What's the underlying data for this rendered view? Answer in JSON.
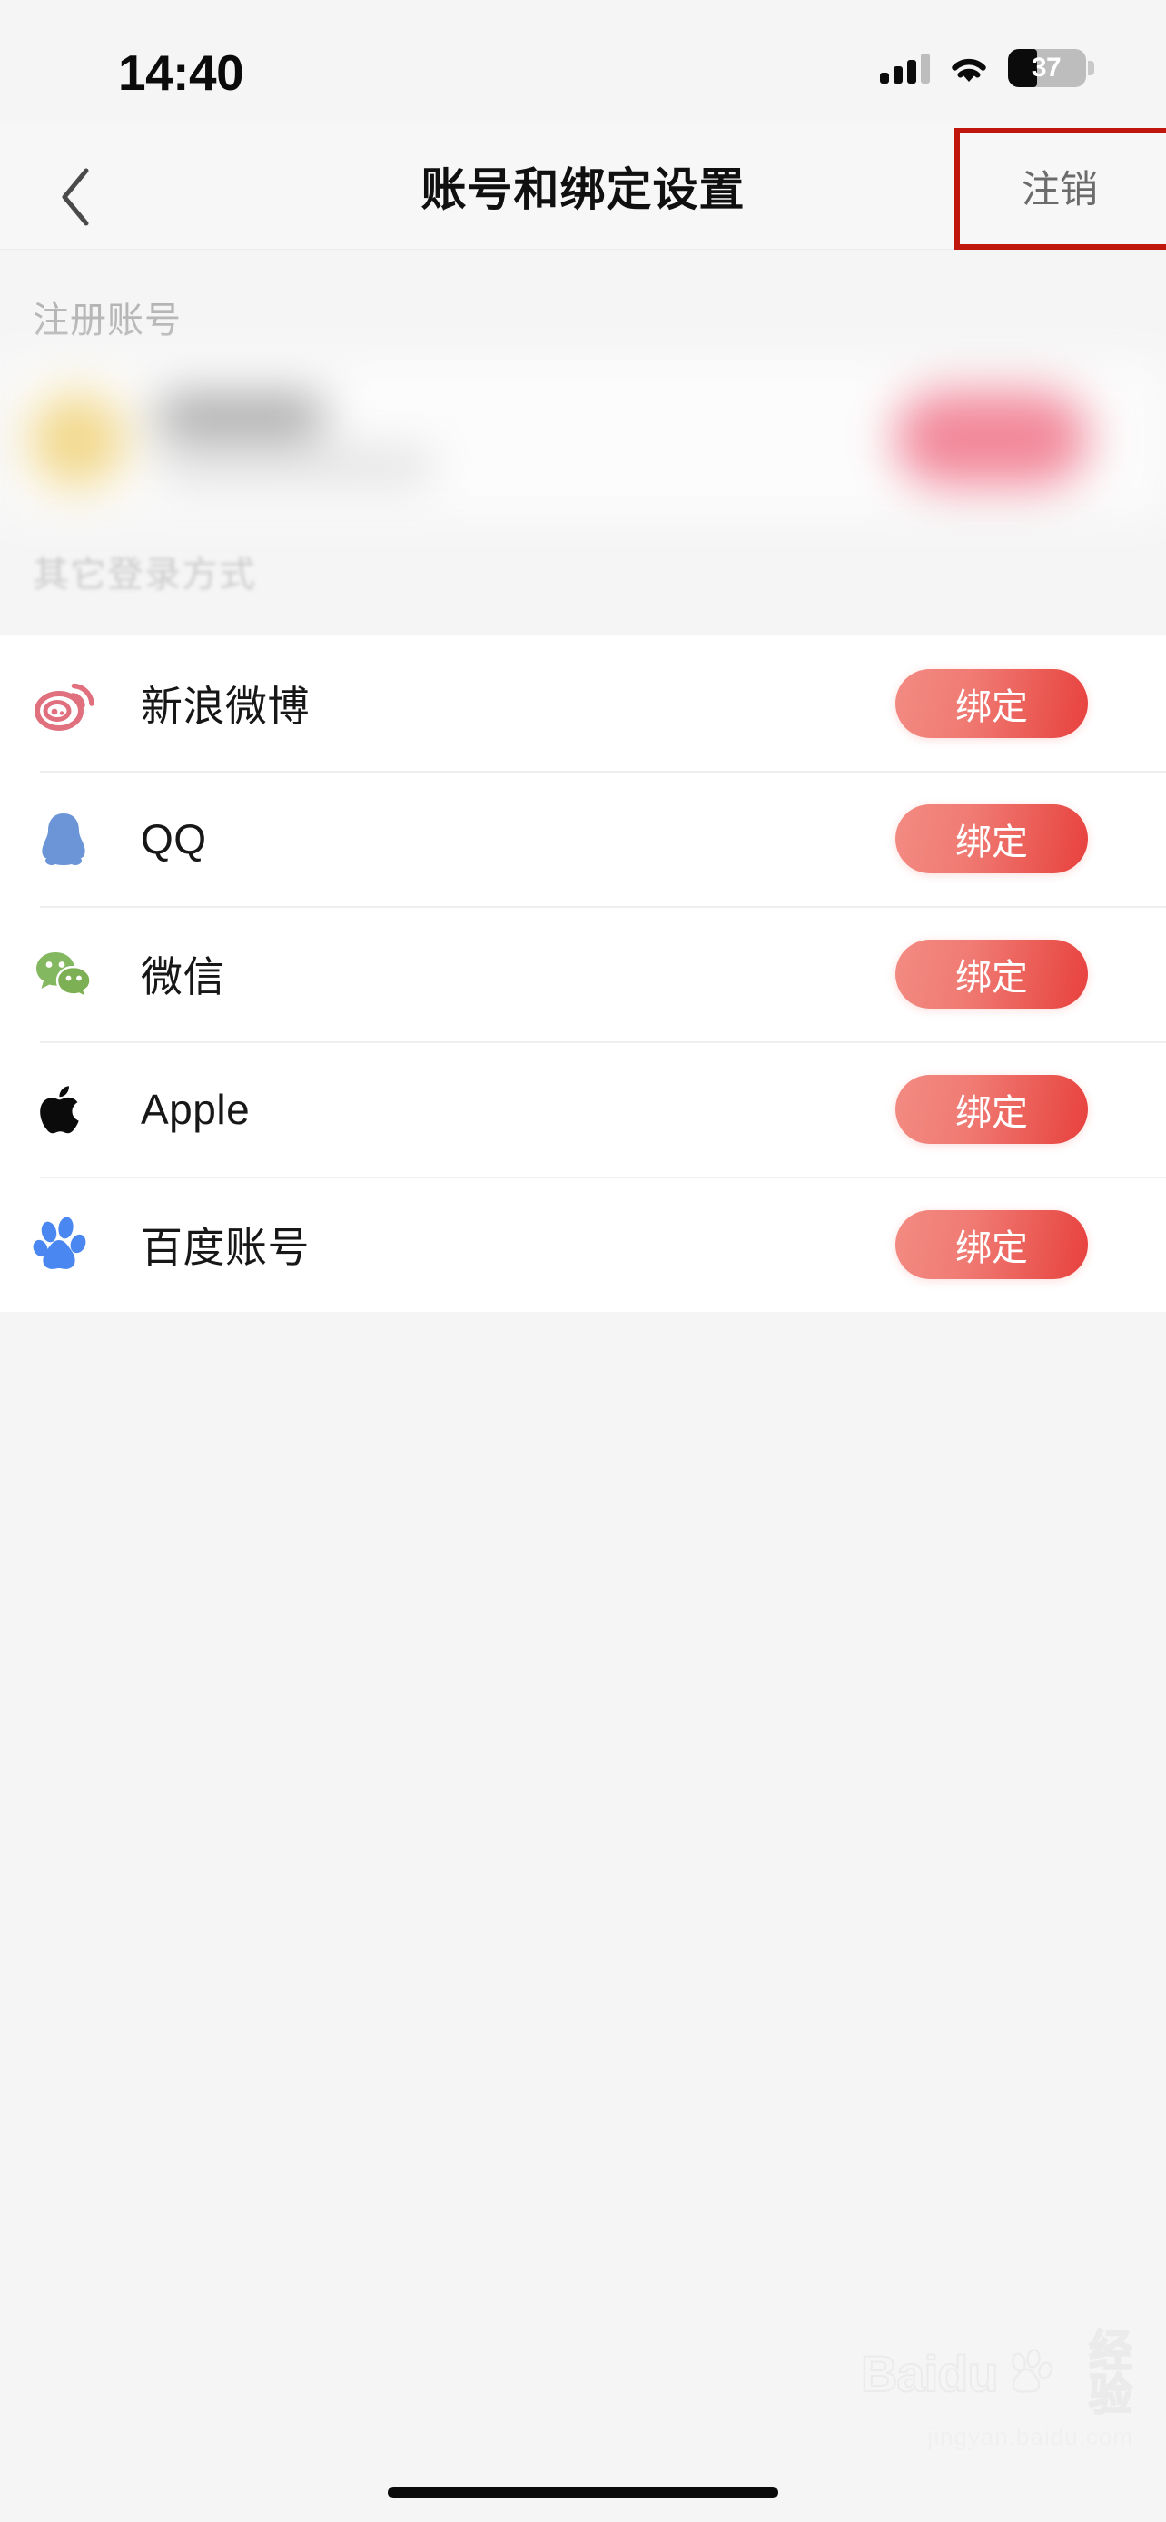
{
  "status_bar": {
    "time": "14:40",
    "signal_icon": "cellular-signal-icon",
    "signal_bars_filled": 3,
    "signal_bars_total": 4,
    "wifi_icon": "wifi-icon",
    "battery_icon": "battery-icon",
    "battery_percent": "37",
    "battery_level": 37
  },
  "nav_bar": {
    "back_icon": "chevron-left-icon",
    "title": "账号和绑定设置",
    "action_label": "注销"
  },
  "annotation": {
    "type": "highlight-rectangle",
    "color": "#c0170c",
    "targets": "注销"
  },
  "sections": [
    {
      "header": "注册账号",
      "redacted": true,
      "account_row": {
        "avatar_color": "#f2d88a",
        "button_color": "#f2889a",
        "blurred": true
      }
    },
    {
      "header": "其它登录方式",
      "rows": [
        {
          "icon": "weibo-icon",
          "label": "新浪微博",
          "button_label": "绑定",
          "icon_color": "#e0707e"
        },
        {
          "icon": "qq-icon",
          "label": "QQ",
          "button_label": "绑定",
          "icon_color": "#6b95d6"
        },
        {
          "icon": "wechat-icon",
          "label": "微信",
          "button_label": "绑定",
          "icon_color": "#7fb45e"
        },
        {
          "icon": "apple-icon",
          "label": "Apple",
          "button_label": "绑定",
          "icon_color": "#0b0b0b"
        },
        {
          "icon": "baidu-icon",
          "label": "百度账号",
          "button_label": "绑定",
          "icon_color": "#4285f4"
        }
      ]
    }
  ],
  "watermark": {
    "brand": "Baidu",
    "brand_cn": "经验",
    "url": "jingyan.baidu.com"
  },
  "colors": {
    "page_background": "#f5f5f5",
    "card_background": "#ffffff",
    "nav_background": "#f7f7f7",
    "primary_text": "#171717",
    "muted_text": "#b5b5b5",
    "button_gradient_start": "#f28b82",
    "button_gradient_end": "#e8413e",
    "annotation_red": "#c0170c"
  }
}
